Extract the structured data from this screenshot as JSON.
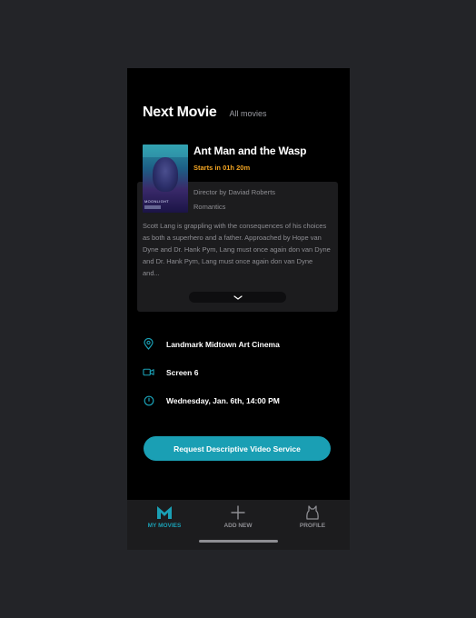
{
  "header": {
    "title": "Next Movie",
    "all_movies": "All movies"
  },
  "movie": {
    "title": "Ant Man and the Wasp",
    "starts": "Starts in 01h 20m",
    "director": "Director by Daviad Roberts",
    "genre": "Romantics",
    "synopsis": "Scott Lang is grappling with the consequences of his choices as both a superhero and a father. Approached by Hope van Dyne and Dr. Hank Pym, Lang must once again don van Dyne and Dr. Hank Pym, Lang must once again don van Dyne and...",
    "poster_title": "MOONLIGHT"
  },
  "details": {
    "venue": "Landmark Midtown Art Cinema",
    "screen": "Screen 6",
    "datetime": "Wednesday, Jan. 6th, 14:00 PM"
  },
  "cta": {
    "label": "Request Descriptive Video Service"
  },
  "tabs": [
    {
      "label": "MY MOVIES",
      "icon": "m-logo-icon"
    },
    {
      "label": "ADD NEW",
      "icon": "plus-icon"
    },
    {
      "label": "PROFILE",
      "icon": "profile-icon"
    }
  ],
  "colors": {
    "accent": "#1a9fb4",
    "highlight": "#f5a623",
    "background": "#000000",
    "card": "#1c1c1e"
  }
}
